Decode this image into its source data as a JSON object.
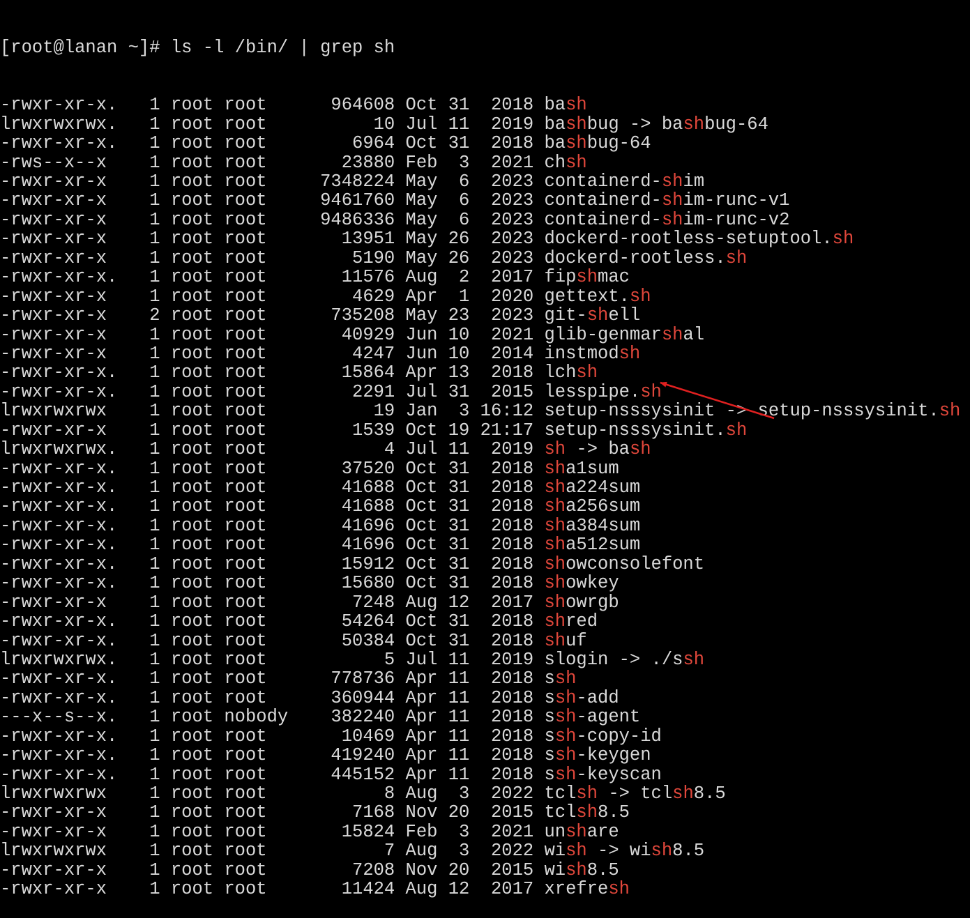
{
  "terminal": {
    "prompt": "[root@lanan ~]#",
    "command": "ls -l /bin/ | grep sh",
    "highlight_term": "sh",
    "colors": {
      "background": "#000000",
      "text": "#d9d9d9",
      "highlight": "#e0473b",
      "annotation_arrow": "#e02020"
    },
    "rows": [
      {
        "perms": "-rwxr-xr-x.",
        "links": "1",
        "owner": "root",
        "group": "root",
        "size": "964608",
        "month": "Oct",
        "day": "31",
        "time": "2018",
        "name": "bash"
      },
      {
        "perms": "lrwxrwxrwx.",
        "links": "1",
        "owner": "root",
        "group": "root",
        "size": "10",
        "month": "Jul",
        "day": "11",
        "time": "2019",
        "name": "bashbug -> bashbug-64"
      },
      {
        "perms": "-rwxr-xr-x.",
        "links": "1",
        "owner": "root",
        "group": "root",
        "size": "6964",
        "month": "Oct",
        "day": "31",
        "time": "2018",
        "name": "bashbug-64"
      },
      {
        "perms": "-rws--x--x",
        "links": "1",
        "owner": "root",
        "group": "root",
        "size": "23880",
        "month": "Feb",
        "day": "3",
        "time": "2021",
        "name": "chsh"
      },
      {
        "perms": "-rwxr-xr-x",
        "links": "1",
        "owner": "root",
        "group": "root",
        "size": "7348224",
        "month": "May",
        "day": "6",
        "time": "2023",
        "name": "containerd-shim"
      },
      {
        "perms": "-rwxr-xr-x",
        "links": "1",
        "owner": "root",
        "group": "root",
        "size": "9461760",
        "month": "May",
        "day": "6",
        "time": "2023",
        "name": "containerd-shim-runc-v1"
      },
      {
        "perms": "-rwxr-xr-x",
        "links": "1",
        "owner": "root",
        "group": "root",
        "size": "9486336",
        "month": "May",
        "day": "6",
        "time": "2023",
        "name": "containerd-shim-runc-v2"
      },
      {
        "perms": "-rwxr-xr-x",
        "links": "1",
        "owner": "root",
        "group": "root",
        "size": "13951",
        "month": "May",
        "day": "26",
        "time": "2023",
        "name": "dockerd-rootless-setuptool.sh"
      },
      {
        "perms": "-rwxr-xr-x",
        "links": "1",
        "owner": "root",
        "group": "root",
        "size": "5190",
        "month": "May",
        "day": "26",
        "time": "2023",
        "name": "dockerd-rootless.sh"
      },
      {
        "perms": "-rwxr-xr-x.",
        "links": "1",
        "owner": "root",
        "group": "root",
        "size": "11576",
        "month": "Aug",
        "day": "2",
        "time": "2017",
        "name": "fipshmac"
      },
      {
        "perms": "-rwxr-xr-x",
        "links": "1",
        "owner": "root",
        "group": "root",
        "size": "4629",
        "month": "Apr",
        "day": "1",
        "time": "2020",
        "name": "gettext.sh"
      },
      {
        "perms": "-rwxr-xr-x",
        "links": "2",
        "owner": "root",
        "group": "root",
        "size": "735208",
        "month": "May",
        "day": "23",
        "time": "2023",
        "name": "git-shell"
      },
      {
        "perms": "-rwxr-xr-x",
        "links": "1",
        "owner": "root",
        "group": "root",
        "size": "40929",
        "month": "Jun",
        "day": "10",
        "time": "2021",
        "name": "glib-genmarshal"
      },
      {
        "perms": "-rwxr-xr-x",
        "links": "1",
        "owner": "root",
        "group": "root",
        "size": "4247",
        "month": "Jun",
        "day": "10",
        "time": "2014",
        "name": "instmodsh"
      },
      {
        "perms": "-rwxr-xr-x.",
        "links": "1",
        "owner": "root",
        "group": "root",
        "size": "15864",
        "month": "Apr",
        "day": "13",
        "time": "2018",
        "name": "lchsh"
      },
      {
        "perms": "-rwxr-xr-x.",
        "links": "1",
        "owner": "root",
        "group": "root",
        "size": "2291",
        "month": "Jul",
        "day": "31",
        "time": "2015",
        "name": "lesspipe.sh"
      },
      {
        "perms": "lrwxrwxrwx",
        "links": "1",
        "owner": "root",
        "group": "root",
        "size": "19",
        "month": "Jan",
        "day": "3",
        "time": "16:12",
        "name": "setup-nsssysinit -> setup-nsssysinit.sh"
      },
      {
        "perms": "-rwxr-xr-x",
        "links": "1",
        "owner": "root",
        "group": "root",
        "size": "1539",
        "month": "Oct",
        "day": "19",
        "time": "21:17",
        "name": "setup-nsssysinit.sh"
      },
      {
        "perms": "lrwxrwxrwx.",
        "links": "1",
        "owner": "root",
        "group": "root",
        "size": "4",
        "month": "Jul",
        "day": "11",
        "time": "2019",
        "name": "sh -> bash"
      },
      {
        "perms": "-rwxr-xr-x.",
        "links": "1",
        "owner": "root",
        "group": "root",
        "size": "37520",
        "month": "Oct",
        "day": "31",
        "time": "2018",
        "name": "sha1sum"
      },
      {
        "perms": "-rwxr-xr-x.",
        "links": "1",
        "owner": "root",
        "group": "root",
        "size": "41688",
        "month": "Oct",
        "day": "31",
        "time": "2018",
        "name": "sha224sum"
      },
      {
        "perms": "-rwxr-xr-x.",
        "links": "1",
        "owner": "root",
        "group": "root",
        "size": "41688",
        "month": "Oct",
        "day": "31",
        "time": "2018",
        "name": "sha256sum"
      },
      {
        "perms": "-rwxr-xr-x.",
        "links": "1",
        "owner": "root",
        "group": "root",
        "size": "41696",
        "month": "Oct",
        "day": "31",
        "time": "2018",
        "name": "sha384sum"
      },
      {
        "perms": "-rwxr-xr-x.",
        "links": "1",
        "owner": "root",
        "group": "root",
        "size": "41696",
        "month": "Oct",
        "day": "31",
        "time": "2018",
        "name": "sha512sum"
      },
      {
        "perms": "-rwxr-xr-x.",
        "links": "1",
        "owner": "root",
        "group": "root",
        "size": "15912",
        "month": "Oct",
        "day": "31",
        "time": "2018",
        "name": "showconsolefont"
      },
      {
        "perms": "-rwxr-xr-x.",
        "links": "1",
        "owner": "root",
        "group": "root",
        "size": "15680",
        "month": "Oct",
        "day": "31",
        "time": "2018",
        "name": "showkey"
      },
      {
        "perms": "-rwxr-xr-x",
        "links": "1",
        "owner": "root",
        "group": "root",
        "size": "7248",
        "month": "Aug",
        "day": "12",
        "time": "2017",
        "name": "showrgb"
      },
      {
        "perms": "-rwxr-xr-x.",
        "links": "1",
        "owner": "root",
        "group": "root",
        "size": "54264",
        "month": "Oct",
        "day": "31",
        "time": "2018",
        "name": "shred"
      },
      {
        "perms": "-rwxr-xr-x.",
        "links": "1",
        "owner": "root",
        "group": "root",
        "size": "50384",
        "month": "Oct",
        "day": "31",
        "time": "2018",
        "name": "shuf"
      },
      {
        "perms": "lrwxrwxrwx.",
        "links": "1",
        "owner": "root",
        "group": "root",
        "size": "5",
        "month": "Jul",
        "day": "11",
        "time": "2019",
        "name": "slogin -> ./ssh"
      },
      {
        "perms": "-rwxr-xr-x.",
        "links": "1",
        "owner": "root",
        "group": "root",
        "size": "778736",
        "month": "Apr",
        "day": "11",
        "time": "2018",
        "name": "ssh"
      },
      {
        "perms": "-rwxr-xr-x.",
        "links": "1",
        "owner": "root",
        "group": "root",
        "size": "360944",
        "month": "Apr",
        "day": "11",
        "time": "2018",
        "name": "ssh-add"
      },
      {
        "perms": "---x--s--x.",
        "links": "1",
        "owner": "root",
        "group": "nobody",
        "size": "382240",
        "month": "Apr",
        "day": "11",
        "time": "2018",
        "name": "ssh-agent"
      },
      {
        "perms": "-rwxr-xr-x.",
        "links": "1",
        "owner": "root",
        "group": "root",
        "size": "10469",
        "month": "Apr",
        "day": "11",
        "time": "2018",
        "name": "ssh-copy-id"
      },
      {
        "perms": "-rwxr-xr-x.",
        "links": "1",
        "owner": "root",
        "group": "root",
        "size": "419240",
        "month": "Apr",
        "day": "11",
        "time": "2018",
        "name": "ssh-keygen"
      },
      {
        "perms": "-rwxr-xr-x.",
        "links": "1",
        "owner": "root",
        "group": "root",
        "size": "445152",
        "month": "Apr",
        "day": "11",
        "time": "2018",
        "name": "ssh-keyscan"
      },
      {
        "perms": "lrwxrwxrwx",
        "links": "1",
        "owner": "root",
        "group": "root",
        "size": "8",
        "month": "Aug",
        "day": "3",
        "time": "2022",
        "name": "tclsh -> tclsh8.5"
      },
      {
        "perms": "-rwxr-xr-x",
        "links": "1",
        "owner": "root",
        "group": "root",
        "size": "7168",
        "month": "Nov",
        "day": "20",
        "time": "2015",
        "name": "tclsh8.5"
      },
      {
        "perms": "-rwxr-xr-x",
        "links": "1",
        "owner": "root",
        "group": "root",
        "size": "15824",
        "month": "Feb",
        "day": "3",
        "time": "2021",
        "name": "unshare"
      },
      {
        "perms": "lrwxrwxrwx",
        "links": "1",
        "owner": "root",
        "group": "root",
        "size": "7",
        "month": "Aug",
        "day": "3",
        "time": "2022",
        "name": "wish -> wish8.5"
      },
      {
        "perms": "-rwxr-xr-x",
        "links": "1",
        "owner": "root",
        "group": "root",
        "size": "7208",
        "month": "Nov",
        "day": "20",
        "time": "2015",
        "name": "wish8.5"
      },
      {
        "perms": "-rwxr-xr-x",
        "links": "1",
        "owner": "root",
        "group": "root",
        "size": "11424",
        "month": "Aug",
        "day": "12",
        "time": "2017",
        "name": "xrefresh"
      }
    ]
  },
  "annotation": {
    "type": "arrow",
    "target_row_name": "sh -> bash"
  }
}
